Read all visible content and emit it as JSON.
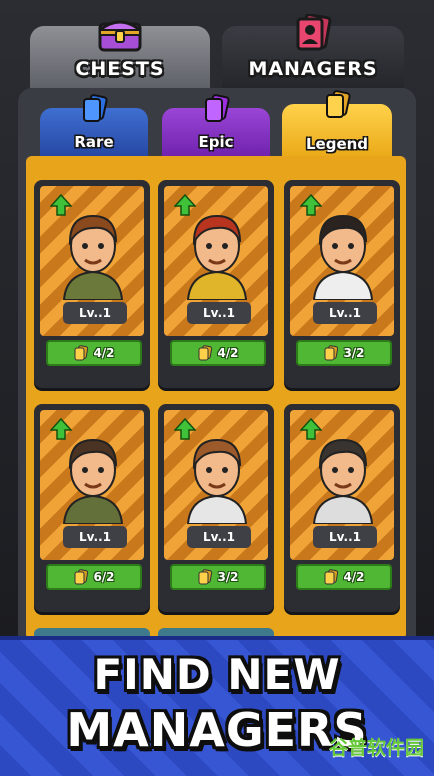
{
  "tabs": {
    "chests": {
      "label": "CHESTS",
      "icon": "chest-icon"
    },
    "managers": {
      "label": "MANAGERS",
      "icon": "manager-card-icon"
    }
  },
  "subtabs": [
    {
      "label": "Rare",
      "icon": "blue-card-icon",
      "color": "#3a63c6"
    },
    {
      "label": "Epic",
      "icon": "purple-card-icon",
      "color": "#8c3bce"
    },
    {
      "label": "Legend",
      "icon": "gold-card-icon",
      "color": "#f2b928",
      "selected": true
    }
  ],
  "cards": [
    {
      "level": "Lv..1",
      "count": "4/2",
      "icon": "upgrade-arrow-icon"
    },
    {
      "level": "Lv..1",
      "count": "4/2",
      "icon": "upgrade-arrow-icon"
    },
    {
      "level": "Lv..1",
      "count": "3/2",
      "icon": "upgrade-arrow-icon"
    },
    {
      "level": "Lv..1",
      "count": "6/2",
      "icon": "upgrade-arrow-icon"
    },
    {
      "level": "Lv..1",
      "count": "3/2",
      "icon": "upgrade-arrow-icon"
    },
    {
      "level": "Lv..1",
      "count": "4/2",
      "icon": "upgrade-arrow-icon"
    }
  ],
  "banner": {
    "line1": "FIND NEW",
    "line2": "MANAGERS"
  },
  "watermark": "谷普软件园",
  "colors": {
    "gold": "#e8a51b",
    "green": "#4fb733",
    "banner_blue": "#3250cc"
  }
}
